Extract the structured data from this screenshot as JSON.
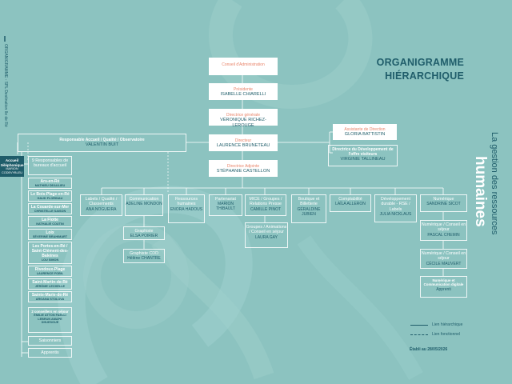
{
  "page": {
    "title_line1": "ORGANIGRAMME",
    "title_line2": "HIÉRARCHIQUE",
    "side_small": "La gestion des ressources",
    "side_big": "humaines",
    "vertical_label": "ORGANIGRAMME - SPL Destination Ile de Ré",
    "legend_hier": "Lien hiérarchique",
    "legend_func": "Lien fonctionnel",
    "date": "Établi au 28/05/2026"
  },
  "top": {
    "conseil": "Conseil d'Administration",
    "president_title": "Présidente",
    "president_name": "ISABELLE CHIARELLI",
    "dg_title": "Directrice générale",
    "dg_name": "VÉRONIQUE RICHEZ-LEROUGE",
    "dir_title": "Directeur",
    "dir_name": "LAURENCE BRUNETEAU",
    "adj_title": "Directrice Adjointe",
    "adj_name": "STÉPHANIE CASTELLON"
  },
  "right": {
    "assist_title": "Assistante de Direction",
    "assist_name": "GLORIA BATTISTIN",
    "dev_title": "Directrice du Développement de l'offre visiteurs",
    "dev_name": "VIRGINIE TALLINEAU"
  },
  "accueil": {
    "resp_title": "Responsable Accueil / Qualité / Observatoire",
    "resp_name": "VALENTIN BUIT",
    "tel_title": "Accueil téléphonique",
    "tel_name": "MARION CODEVYBLEU",
    "bureaux": "9 Responsables de bureaux d'accueil",
    "offices": [
      {
        "lbl": "Ars-en-Ré",
        "sub": "MATHIEU DEAULIEU"
      },
      {
        "lbl": "Le Bois-Plage-en-Ré",
        "sub": "HAUD FLORINAU"
      },
      {
        "lbl": "La Couarde-sur-Mer",
        "sub": "CHRISTELLE SAISON"
      },
      {
        "lbl": "La Flotte",
        "sub": "NATHALIE COUTIN"
      },
      {
        "lbl": "Loix",
        "sub": "SÉVERINE BRAHIMART"
      },
      {
        "lbl": "Les Portes-en-Ré / Saint-Clément-des-Baleines",
        "sub": "LOU SIMON"
      },
      {
        "lbl": "Rivedoux-Plage",
        "sub": "LAURENCE FOBIL"
      },
      {
        "lbl": "Saint-Martin-de-Ré",
        "sub": "JÉRÔME LECHELLE"
      },
      {
        "lbl": "Sainte-Marie-de-Ré",
        "sub": "ARGANA STOLOVA"
      }
    ],
    "conseillers_title": "2 conseillers en séjour",
    "conseillers_names": "ÉMILIE ATTON  FAELLI LEBRUN  AMAPE DHUESGUE",
    "saisonniers": "Saisonniers",
    "apprentis": "Apprentis"
  },
  "depts": [
    {
      "title": "Labels / Qualité / Classements",
      "name": "ANA NOGUEIRA"
    },
    {
      "title": "Communication",
      "name": "ADELINE MONDON"
    },
    {
      "title": "Ressources humaines",
      "name": "ENORA HADOUS"
    },
    {
      "title": "Partenariat",
      "name": "MARION THIBAULT"
    },
    {
      "title": "MICE / Groupes / Relations Presse",
      "name": "CAMILLE PINOT"
    },
    {
      "title": "Boutique et Billetterie",
      "name": "GÉRALDINE JUBIEN"
    },
    {
      "title": "Comptabilité",
      "name": "LAÏLA ALLERON"
    },
    {
      "title": "Développement durable - RSE / Labels",
      "name": "JULIA NICKLAUS"
    },
    {
      "title": "Numérique",
      "name": "SANDRINE SICOT"
    }
  ],
  "sub": {
    "graphiste_title": "Graphiste",
    "graphiste_name": "ELSA POIRIER",
    "graphcdd_title": "Graphiste CDD",
    "graphcdd_name": "Hélène CHANTRE",
    "groupes_title": "Groupes / Animations / Conseil en séjour",
    "groupes_name": "LAURA GAY",
    "num1_title": "Numérique / Conseil en séjour",
    "num1_name": "PASCAL CHEMIN",
    "num2_title": "Numérique / Conseil en séjour",
    "num2_name": "CÉCILE MAUVERT",
    "num3_title": "Numérique et Communication digitale",
    "num3_name": "Apprenti"
  }
}
